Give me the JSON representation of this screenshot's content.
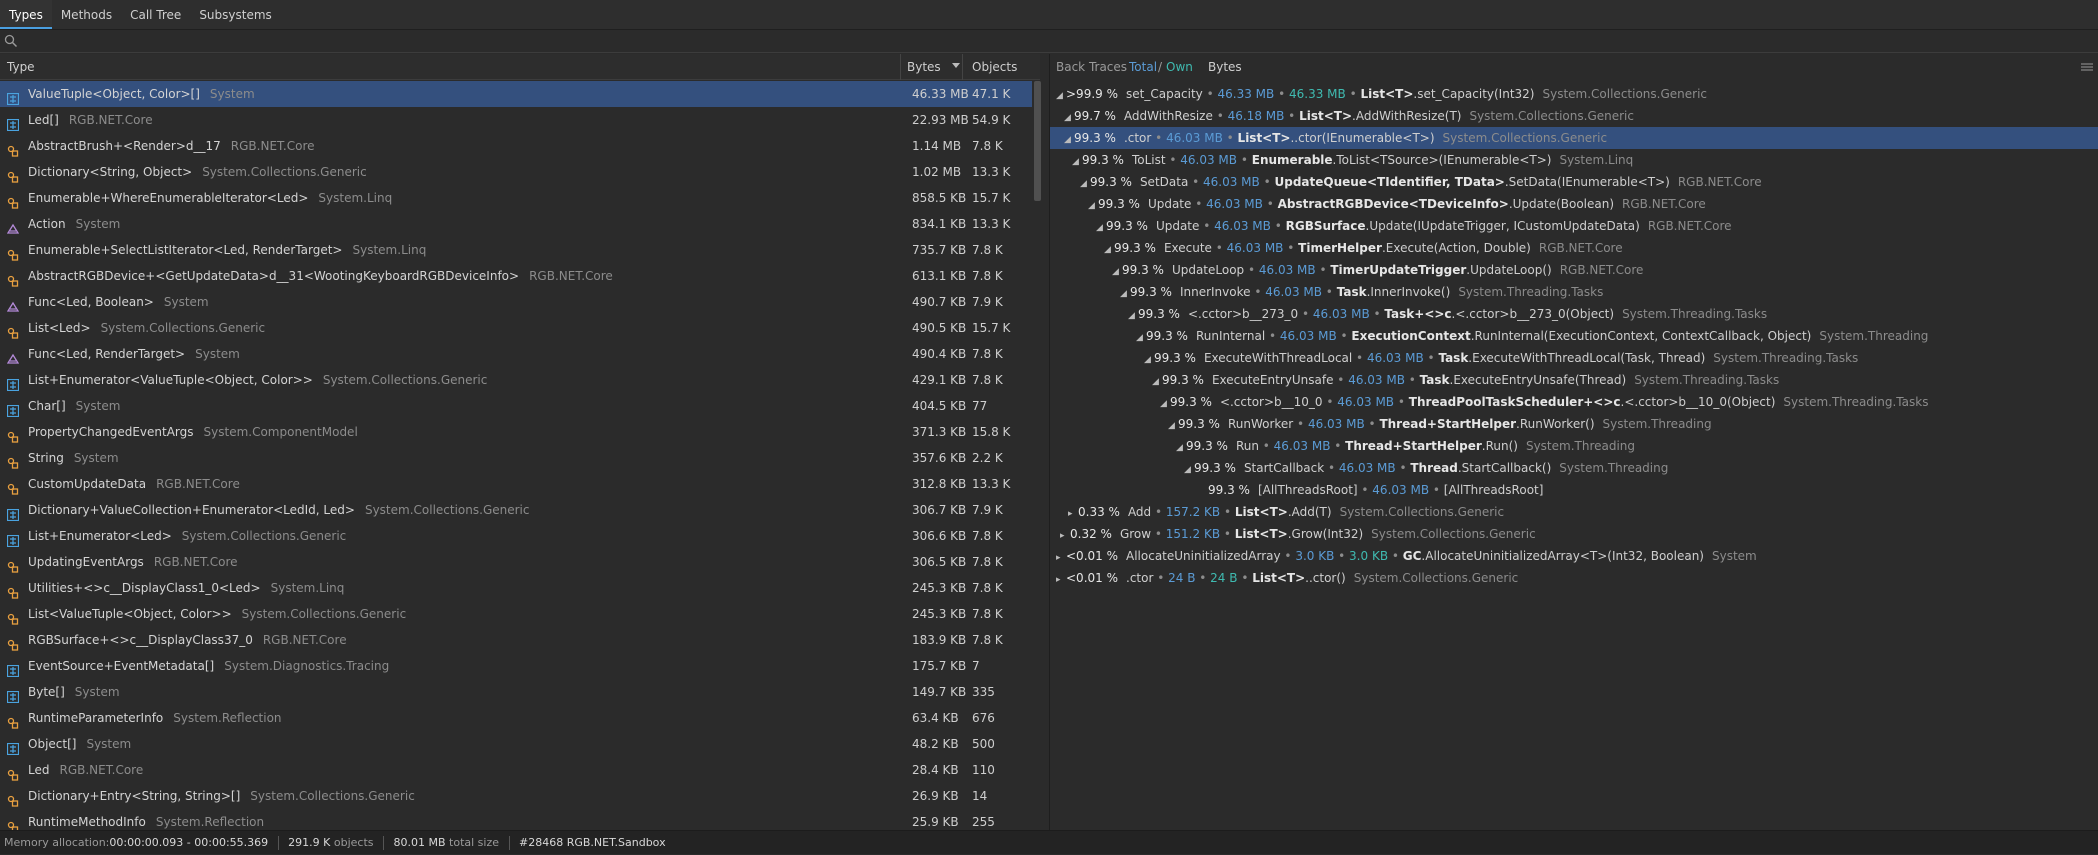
{
  "tabs": [
    {
      "label": "Types",
      "active": true
    },
    {
      "label": "Methods"
    },
    {
      "label": "Call Tree"
    },
    {
      "label": "Subsystems"
    }
  ],
  "search": {
    "placeholder": "",
    "value": ""
  },
  "types_table": {
    "columns": {
      "type": "Type",
      "bytes": "Bytes",
      "objects": "Objects"
    },
    "sort": "bytes-descending",
    "rows": [
      {
        "icon": "struct-icon",
        "name": "ValueTuple<Object, Color>[]",
        "ns": "System",
        "bytes": "46.33 MB",
        "objects": "47.1 K",
        "selected": true
      },
      {
        "icon": "struct-icon",
        "name": "Led[]",
        "ns": "RGB.NET.Core",
        "bytes": "22.93 MB",
        "objects": "54.9 K"
      },
      {
        "icon": "class-icon",
        "name": "AbstractBrush+<Render>d__17",
        "ns": "RGB.NET.Core",
        "bytes": "1.14 MB",
        "objects": "7.8 K"
      },
      {
        "icon": "class-icon",
        "name": "Dictionary<String, Object>",
        "ns": "System.Collections.Generic",
        "bytes": "1.02 MB",
        "objects": "13.3 K"
      },
      {
        "icon": "class-icon",
        "name": "Enumerable+WhereEnumerableIterator<Led>",
        "ns": "System.Linq",
        "bytes": "858.5 KB",
        "objects": "15.7 K"
      },
      {
        "icon": "delegate-icon",
        "name": "Action",
        "ns": "System",
        "bytes": "834.1 KB",
        "objects": "13.3 K"
      },
      {
        "icon": "class-icon",
        "name": "Enumerable+SelectListIterator<Led, RenderTarget>",
        "ns": "System.Linq",
        "bytes": "735.7 KB",
        "objects": "7.8 K"
      },
      {
        "icon": "class-icon",
        "name": "AbstractRGBDevice+<GetUpdateData>d__31<WootingKeyboardRGBDeviceInfo>",
        "ns": "RGB.NET.Core",
        "bytes": "613.1 KB",
        "objects": "7.8 K"
      },
      {
        "icon": "delegate-icon",
        "name": "Func<Led, Boolean>",
        "ns": "System",
        "bytes": "490.7 KB",
        "objects": "7.9 K"
      },
      {
        "icon": "class-icon",
        "name": "List<Led>",
        "ns": "System.Collections.Generic",
        "bytes": "490.5 KB",
        "objects": "15.7 K"
      },
      {
        "icon": "delegate-icon",
        "name": "Func<Led, RenderTarget>",
        "ns": "System",
        "bytes": "490.4 KB",
        "objects": "7.8 K"
      },
      {
        "icon": "struct-icon",
        "name": "List+Enumerator<ValueTuple<Object, Color>>",
        "ns": "System.Collections.Generic",
        "bytes": "429.1 KB",
        "objects": "7.8 K"
      },
      {
        "icon": "struct-icon",
        "name": "Char[]",
        "ns": "System",
        "bytes": "404.5 KB",
        "objects": "77"
      },
      {
        "icon": "class-icon",
        "name": "PropertyChangedEventArgs",
        "ns": "System.ComponentModel",
        "bytes": "371.3 KB",
        "objects": "15.8 K"
      },
      {
        "icon": "class-icon",
        "name": "String",
        "ns": "System",
        "bytes": "357.6 KB",
        "objects": "2.2 K"
      },
      {
        "icon": "class-icon",
        "name": "CustomUpdateData",
        "ns": "RGB.NET.Core",
        "bytes": "312.8 KB",
        "objects": "13.3 K"
      },
      {
        "icon": "struct-icon",
        "name": "Dictionary+ValueCollection+Enumerator<LedId, Led>",
        "ns": "System.Collections.Generic",
        "bytes": "306.7 KB",
        "objects": "7.9 K"
      },
      {
        "icon": "struct-icon",
        "name": "List+Enumerator<Led>",
        "ns": "System.Collections.Generic",
        "bytes": "306.6 KB",
        "objects": "7.8 K"
      },
      {
        "icon": "class-icon",
        "name": "UpdatingEventArgs",
        "ns": "RGB.NET.Core",
        "bytes": "306.5 KB",
        "objects": "7.8 K"
      },
      {
        "icon": "class-icon",
        "name": "Utilities+<>c__DisplayClass1_0<Led>",
        "ns": "System.Linq",
        "bytes": "245.3 KB",
        "objects": "7.8 K"
      },
      {
        "icon": "class-icon",
        "name": "List<ValueTuple<Object, Color>>",
        "ns": "System.Collections.Generic",
        "bytes": "245.3 KB",
        "objects": "7.8 K"
      },
      {
        "icon": "class-icon",
        "name": "RGBSurface+<>c__DisplayClass37_0",
        "ns": "RGB.NET.Core",
        "bytes": "183.9 KB",
        "objects": "7.8 K"
      },
      {
        "icon": "struct-icon",
        "name": "EventSource+EventMetadata[]",
        "ns": "System.Diagnostics.Tracing",
        "bytes": "175.7 KB",
        "objects": "7"
      },
      {
        "icon": "struct-icon",
        "name": "Byte[]",
        "ns": "System",
        "bytes": "149.7 KB",
        "objects": "335"
      },
      {
        "icon": "class-icon",
        "name": "RuntimeParameterInfo",
        "ns": "System.Reflection",
        "bytes": "63.4 KB",
        "objects": "676"
      },
      {
        "icon": "struct-icon",
        "name": "Object[]",
        "ns": "System",
        "bytes": "48.2 KB",
        "objects": "500"
      },
      {
        "icon": "class-icon",
        "name": "Led",
        "ns": "RGB.NET.Core",
        "bytes": "28.4 KB",
        "objects": "110"
      },
      {
        "icon": "class-icon",
        "name": "Dictionary+Entry<String, String>[]",
        "ns": "System.Collections.Generic",
        "bytes": "26.9 KB",
        "objects": "14"
      },
      {
        "icon": "class-icon",
        "name": "RuntimeMethodInfo",
        "ns": "System.Reflection",
        "bytes": "25.9 KB",
        "objects": "255"
      }
    ]
  },
  "back_traces": {
    "header": {
      "title": "Back Traces",
      "total": "Total",
      "slash": "/",
      "own": "Own",
      "bytes": "Bytes"
    },
    "nodes": [
      {
        "arrow": "◢",
        "pct": ">99.9 %",
        "method": "set_Capacity",
        "total": "46.33 MB",
        "own": "46.33 MB",
        "cls": "List<T>",
        "rest": ".set_Capacity(Int32)",
        "ns": "System.Collections.Generic"
      },
      {
        "arrow": "◢",
        "pct": "99.7 %",
        "method": "AddWithResize",
        "total": "46.18 MB",
        "cls": "List<T>",
        "rest": ".AddWithResize(T)",
        "ns": "System.Collections.Generic"
      },
      {
        "arrow": "◢",
        "pct": "99.3 %",
        "method": ".ctor",
        "total": "46.03 MB",
        "cls": "List<T>",
        "rest": "..ctor(IEnumerable<T>)",
        "ns": "System.Collections.Generic",
        "selected": true
      },
      {
        "arrow": "◢",
        "pct": "99.3 %",
        "method": "ToList",
        "total": "46.03 MB",
        "cls": "Enumerable",
        "rest": ".ToList<TSource>(IEnumerable<T>)",
        "ns": "System.Linq"
      },
      {
        "arrow": "◢",
        "pct": "99.3 %",
        "method": "SetData",
        "total": "46.03 MB",
        "cls": "UpdateQueue<TIdentifier, TData>",
        "rest": ".SetData(IEnumerable<T>)",
        "ns": "RGB.NET.Core"
      },
      {
        "arrow": "◢",
        "pct": "99.3 %",
        "method": "Update",
        "total": "46.03 MB",
        "cls": "AbstractRGBDevice<TDeviceInfo>",
        "rest": ".Update(Boolean)",
        "ns": "RGB.NET.Core"
      },
      {
        "arrow": "◢",
        "pct": "99.3 %",
        "method": "Update",
        "total": "46.03 MB",
        "cls": "RGBSurface",
        "rest": ".Update(IUpdateTrigger, ICustomUpdateData)",
        "ns": "RGB.NET.Core"
      },
      {
        "arrow": "◢",
        "pct": "99.3 %",
        "method": "Execute",
        "total": "46.03 MB",
        "cls": "TimerHelper",
        "rest": ".Execute(Action, Double)",
        "ns": "RGB.NET.Core"
      },
      {
        "arrow": "◢",
        "pct": "99.3 %",
        "method": "UpdateLoop",
        "total": "46.03 MB",
        "cls": "TimerUpdateTrigger",
        "rest": ".UpdateLoop()",
        "ns": "RGB.NET.Core"
      },
      {
        "arrow": "◢",
        "pct": "99.3 %",
        "method": "InnerInvoke",
        "total": "46.03 MB",
        "cls": "Task",
        "rest": ".InnerInvoke()",
        "ns": "System.Threading.Tasks"
      },
      {
        "arrow": "◢",
        "pct": "99.3 %",
        "method": "<.cctor>b__273_0",
        "total": "46.03 MB",
        "cls": "Task+<>c",
        "rest": ".<.cctor>b__273_0(Object)",
        "ns": "System.Threading.Tasks"
      },
      {
        "arrow": "◢",
        "pct": "99.3 %",
        "method": "RunInternal",
        "total": "46.03 MB",
        "cls": "ExecutionContext",
        "rest": ".RunInternal(ExecutionContext, ContextCallback, Object)",
        "ns": "System.Threading"
      },
      {
        "arrow": "◢",
        "pct": "99.3 %",
        "method": "ExecuteWithThreadLocal",
        "total": "46.03 MB",
        "cls": "Task",
        "rest": ".ExecuteWithThreadLocal(Task, Thread)",
        "ns": "System.Threading.Tasks"
      },
      {
        "arrow": "◢",
        "pct": "99.3 %",
        "method": "ExecuteEntryUnsafe",
        "total": "46.03 MB",
        "cls": "Task",
        "rest": ".ExecuteEntryUnsafe(Thread)",
        "ns": "System.Threading.Tasks"
      },
      {
        "arrow": "◢",
        "pct": "99.3 %",
        "method": "<.cctor>b__10_0",
        "total": "46.03 MB",
        "cls": "ThreadPoolTaskScheduler+<>c",
        "rest": ".<.cctor>b__10_0(Object)",
        "ns": "System.Threading.Tasks"
      },
      {
        "arrow": "◢",
        "pct": "99.3 %",
        "method": "RunWorker",
        "total": "46.03 MB",
        "cls": "Thread+StartHelper",
        "rest": ".RunWorker()",
        "ns": "System.Threading"
      },
      {
        "arrow": "◢",
        "pct": "99.3 %",
        "method": "Run",
        "total": "46.03 MB",
        "cls": "Thread+StartHelper",
        "rest": ".Run()",
        "ns": "System.Threading"
      },
      {
        "arrow": "◢",
        "pct": "99.3 %",
        "method": "StartCallback",
        "total": "46.03 MB",
        "cls": "Thread",
        "rest": ".StartCallback()",
        "ns": "System.Threading"
      },
      {
        "arrow": "",
        "pct": "99.3 %",
        "method": "[AllThreadsRoot]",
        "total": "46.03 MB",
        "cls": "",
        "rest": "[AllThreadsRoot]",
        "ns": ""
      },
      {
        "arrow": "▸",
        "pct": "0.33 %",
        "method": "Add",
        "total": "157.2 KB",
        "cls": "List<T>",
        "rest": ".Add(T)",
        "ns": "System.Collections.Generic"
      },
      {
        "arrow": "▸",
        "pct": "0.32 %",
        "method": "Grow",
        "total": "151.2 KB",
        "cls": "List<T>",
        "rest": ".Grow(Int32)",
        "ns": "System.Collections.Generic"
      },
      {
        "arrow": "▸",
        "pct": "<0.01 %",
        "method": "AllocateUninitializedArray",
        "total": "3.0 KB",
        "own": "3.0 KB",
        "cls": "GC",
        "rest": ".AllocateUninitializedArray<T>(Int32, Boolean)",
        "ns": "System"
      },
      {
        "arrow": "▸",
        "pct": "<0.01 %",
        "method": ".ctor",
        "total": "24 B",
        "own": "24 B",
        "cls": "List<T>",
        "rest": "..ctor()",
        "ns": "System.Collections.Generic"
      }
    ]
  },
  "status": {
    "label": "Memory allocation:",
    "range": "00:00:00.093 - 00:00:55.369",
    "objects_value": "291.9 K",
    "objects_label": "objects",
    "size_value": "80.01 MB",
    "size_label": "total size",
    "process": "#28468 RGB.NET.Sandbox"
  }
}
